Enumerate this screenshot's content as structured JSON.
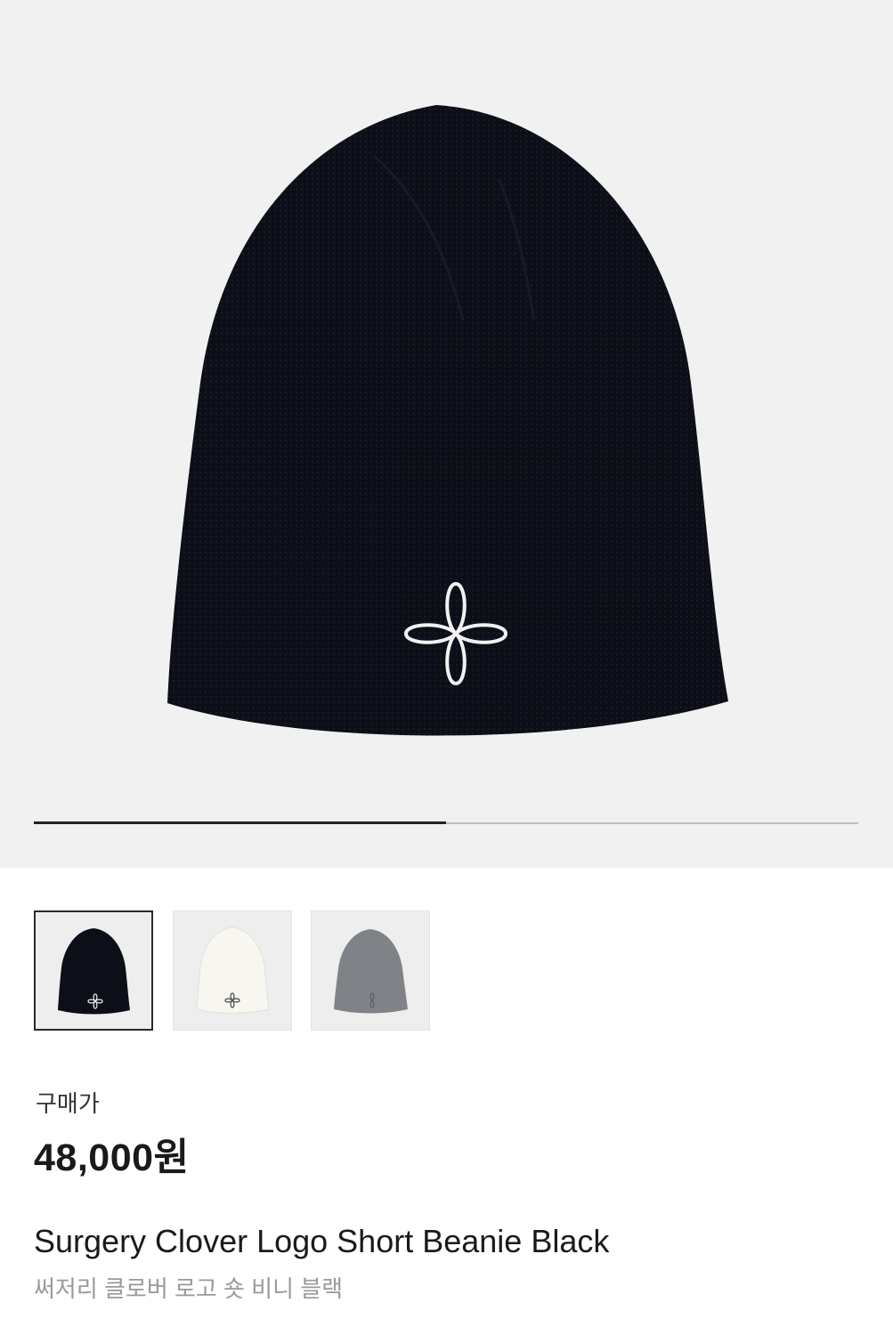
{
  "gallery": {
    "progress_fraction": 0.5,
    "thumbnails": [
      {
        "color": "Black",
        "selected": true
      },
      {
        "color": "White",
        "selected": false
      },
      {
        "color": "Gray",
        "selected": false
      }
    ]
  },
  "price": {
    "label": "구매가",
    "value": "48,000원"
  },
  "product": {
    "name_en": "Surgery Clover Logo Short Beanie Black",
    "name_ko": "써저리 클로버 로고 숏 비니 블랙"
  },
  "colors": {
    "hero_background": "#f1f1f1",
    "beanie_black": "#0c0f17",
    "beanie_white": "#f7f6f1",
    "beanie_gray": "#7f8287",
    "logo_white": "#f2f2f2"
  }
}
